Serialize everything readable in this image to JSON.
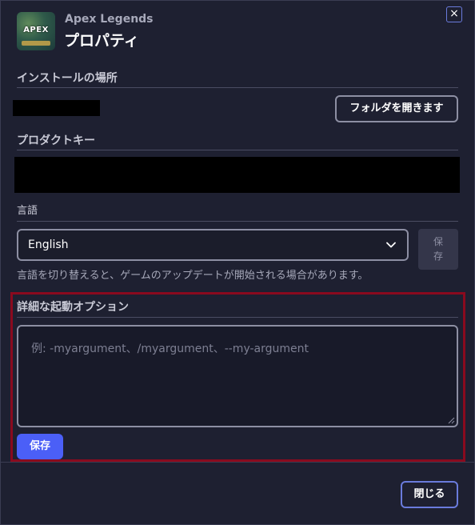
{
  "header": {
    "app_name": "Apex Legends",
    "title": "プロパティ",
    "icon_text": "APEX",
    "close_glyph": "×"
  },
  "install": {
    "label": "インストールの場所",
    "open_folder_label": "フォルダを開きます"
  },
  "product_key": {
    "label": "プロダクトキー"
  },
  "language": {
    "label": "言語",
    "selected": "English",
    "save_label": "保存",
    "hint": "言語を切り替えると、ゲームのアップデートが開始される場合があります。"
  },
  "launch_options": {
    "label": "詳細な起動オプション",
    "placeholder": "例: -myargument、/myargument、--my-argument",
    "save_label": "保存"
  },
  "footer": {
    "close_label": "閉じる"
  },
  "colors": {
    "background": "#1e2031",
    "primary_button": "#4b5ff7",
    "highlight_border": "#8a0a1e",
    "accent_outline": "#6a7bdc"
  }
}
